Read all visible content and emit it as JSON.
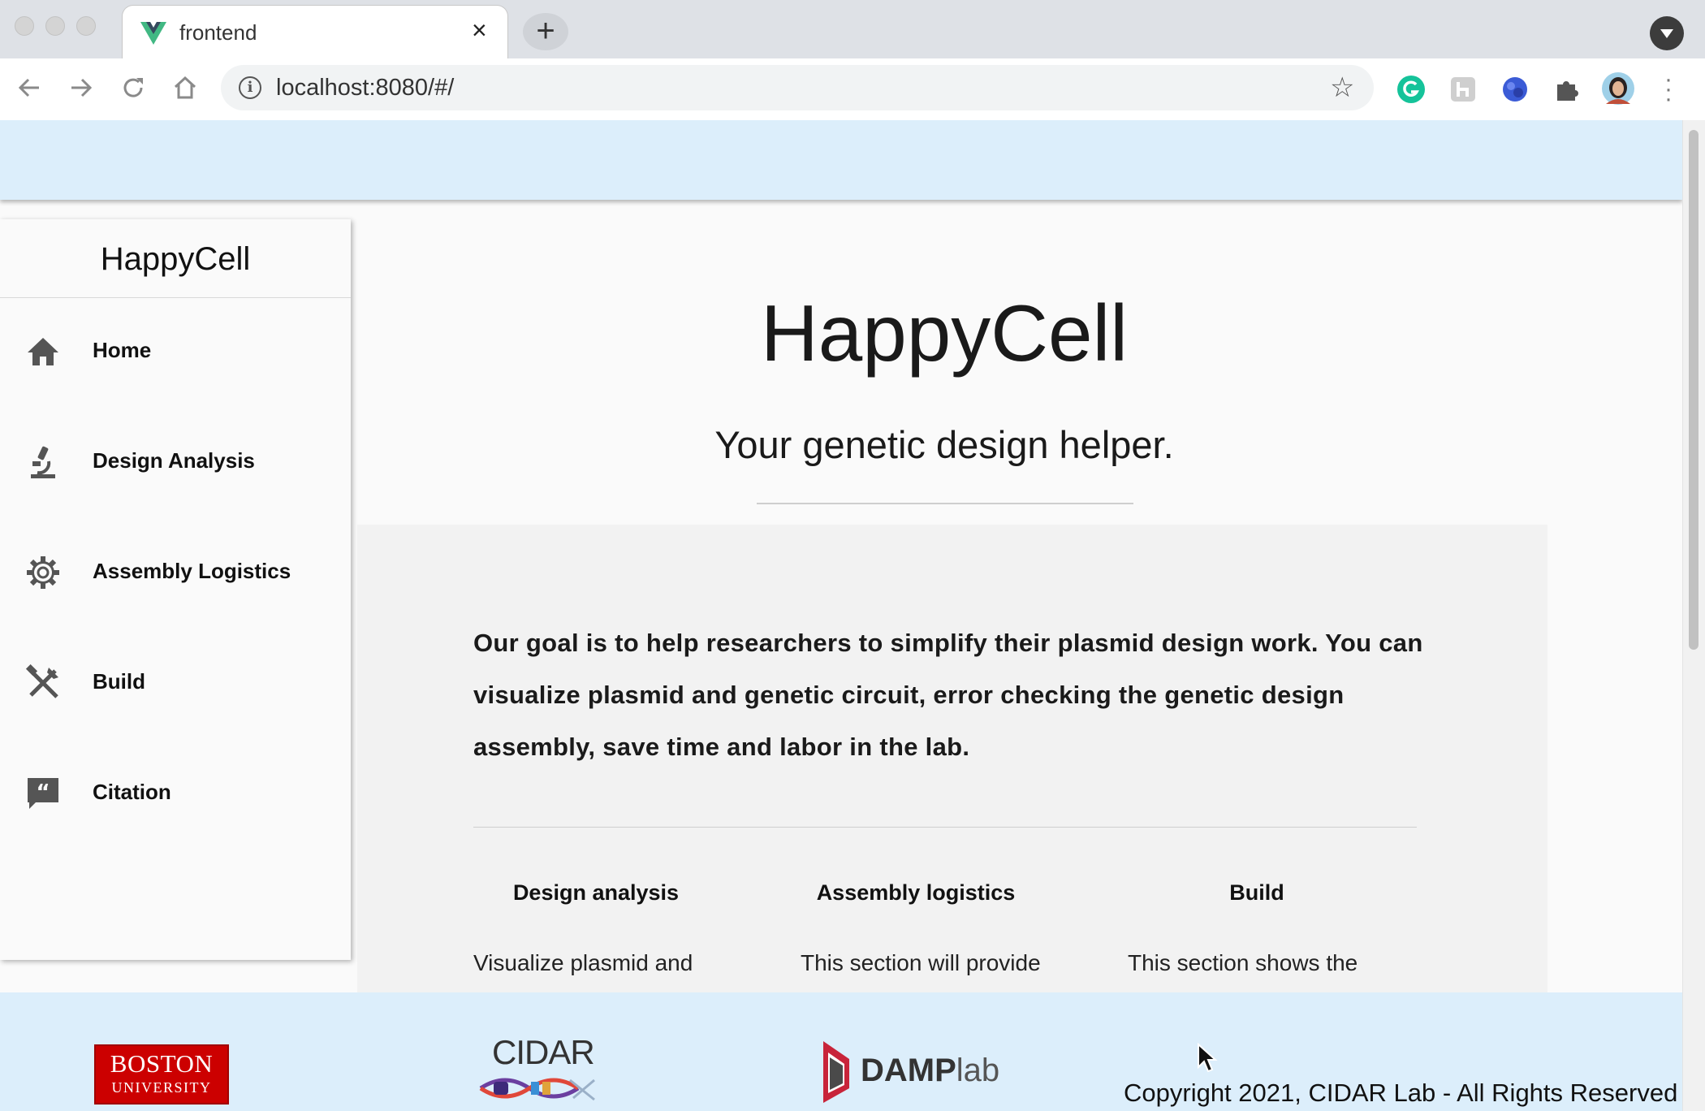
{
  "browser": {
    "tab_title": "frontend",
    "tab_close": "×",
    "new_tab": "+",
    "url": "localhost:8080/#/",
    "info_glyph": "i",
    "bookmark_glyph": "☆",
    "extensions": [
      "grammarly-icon",
      "extension-h-icon",
      "extension-globe-icon",
      "extensions-puzzle-icon",
      "profile-avatar"
    ]
  },
  "sidebar": {
    "title": "HappyCell",
    "items": [
      {
        "label": "Home",
        "icon": "home-icon"
      },
      {
        "label": "Design Analysis",
        "icon": "microscope-icon"
      },
      {
        "label": "Assembly Logistics",
        "icon": "gear-icon"
      },
      {
        "label": "Build",
        "icon": "tools-icon"
      },
      {
        "label": "Citation",
        "icon": "quote-icon"
      }
    ]
  },
  "main": {
    "title": "HappyCell",
    "subtitle": "Your genetic design helper.",
    "intro": "Our goal is to help researchers to simplify their plasmid design work. You can visualize plasmid and genetic circuit, error checking the genetic design assembly, save time and labor in the lab.",
    "features": [
      {
        "title": "Design analysis",
        "text": "Visualize plasmid and"
      },
      {
        "title": "Assembly logistics",
        "text": "This section will provide"
      },
      {
        "title": "Build",
        "text": "This section shows the"
      }
    ]
  },
  "footer": {
    "bu_line1": "BOSTON",
    "bu_line2": "UNIVERSITY",
    "cidar": "CIDAR",
    "damp_bold": "DAMP",
    "damp_light": "lab",
    "copyright": "Copyright 2021, CIDAR Lab - All Rights Reserved"
  },
  "colors": {
    "appbar": "#dceefb",
    "bu_red": "#cc0000",
    "vue_green": "#41b883",
    "grammarly_green": "#15c39a"
  }
}
